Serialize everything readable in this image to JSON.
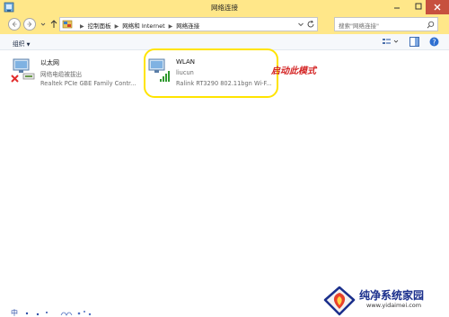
{
  "window": {
    "title": "网络连接"
  },
  "address_bar": {
    "breadcrumbs": [
      "控制面板",
      "网络和 Internet",
      "网络连接"
    ],
    "search_placeholder": "搜索\"网络连接\""
  },
  "command_bar": {
    "organize_label": "组织",
    "organize_caret": "▼"
  },
  "connections": [
    {
      "name": "以太网",
      "status": "网络电缆被拔出",
      "device": "Realtek PCIe GBE Family Contr..."
    },
    {
      "name": "WLAN",
      "status": "liucun",
      "device": "Ralink RT3290 802.11bgn Wi-F..."
    }
  ],
  "annotation": {
    "text": "启动此模式",
    "color": "#d42424",
    "highlight_color": "#ffe400"
  },
  "watermark": {
    "brand": "纯净系统家园",
    "url": "www.yidaimei.com"
  },
  "bottom_strip": {
    "text": "中"
  },
  "colors": {
    "titlebar": "#ffe789",
    "close": "#c7503e"
  }
}
